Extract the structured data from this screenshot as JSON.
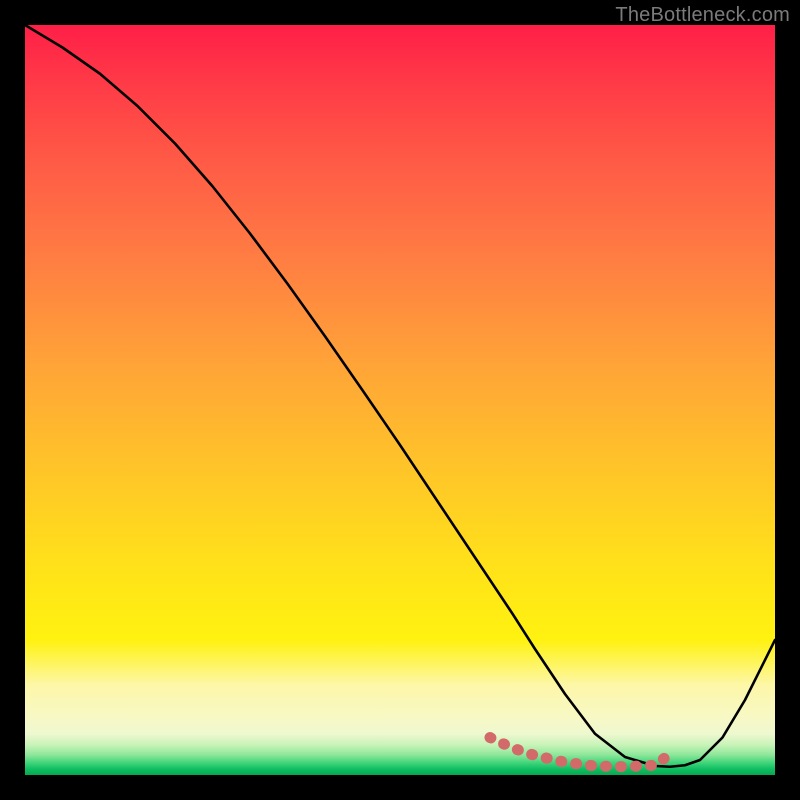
{
  "attribution": "TheBottleneck.com",
  "chart_data": {
    "type": "line",
    "title": "",
    "xlabel": "",
    "ylabel": "",
    "xlim": [
      0,
      100
    ],
    "ylim": [
      0,
      100
    ],
    "grid": false,
    "legend": false,
    "series": [
      {
        "name": "bottleneck-curve",
        "x": [
          0,
          5,
          10,
          15,
          20,
          25,
          30,
          35,
          40,
          45,
          50,
          55,
          60,
          62,
          65,
          68,
          72,
          76,
          80,
          84,
          86,
          88,
          90,
          93,
          96,
          100
        ],
        "values": [
          100,
          97,
          93.5,
          89.2,
          84.2,
          78.5,
          72.2,
          65.5,
          58.5,
          51.3,
          44.0,
          36.5,
          29.0,
          26.0,
          21.5,
          16.8,
          10.8,
          5.5,
          2.4,
          1.2,
          1.1,
          1.3,
          2.0,
          5.0,
          10.0,
          18.0
        ]
      }
    ],
    "highlight_band": {
      "name": "optimal-range",
      "color": "#d36a6a",
      "x": [
        62,
        65,
        68,
        72,
        76,
        80,
        84,
        86
      ],
      "values": [
        5.0,
        3.6,
        2.6,
        1.7,
        1.2,
        1.1,
        1.3,
        2.8
      ]
    },
    "background_gradient": {
      "top": "#ff1f47",
      "mid_upper": "#ff8a3d",
      "mid": "#ffe11a",
      "pale_band": "#f7f8c6",
      "bottom": "#07a84f"
    }
  }
}
